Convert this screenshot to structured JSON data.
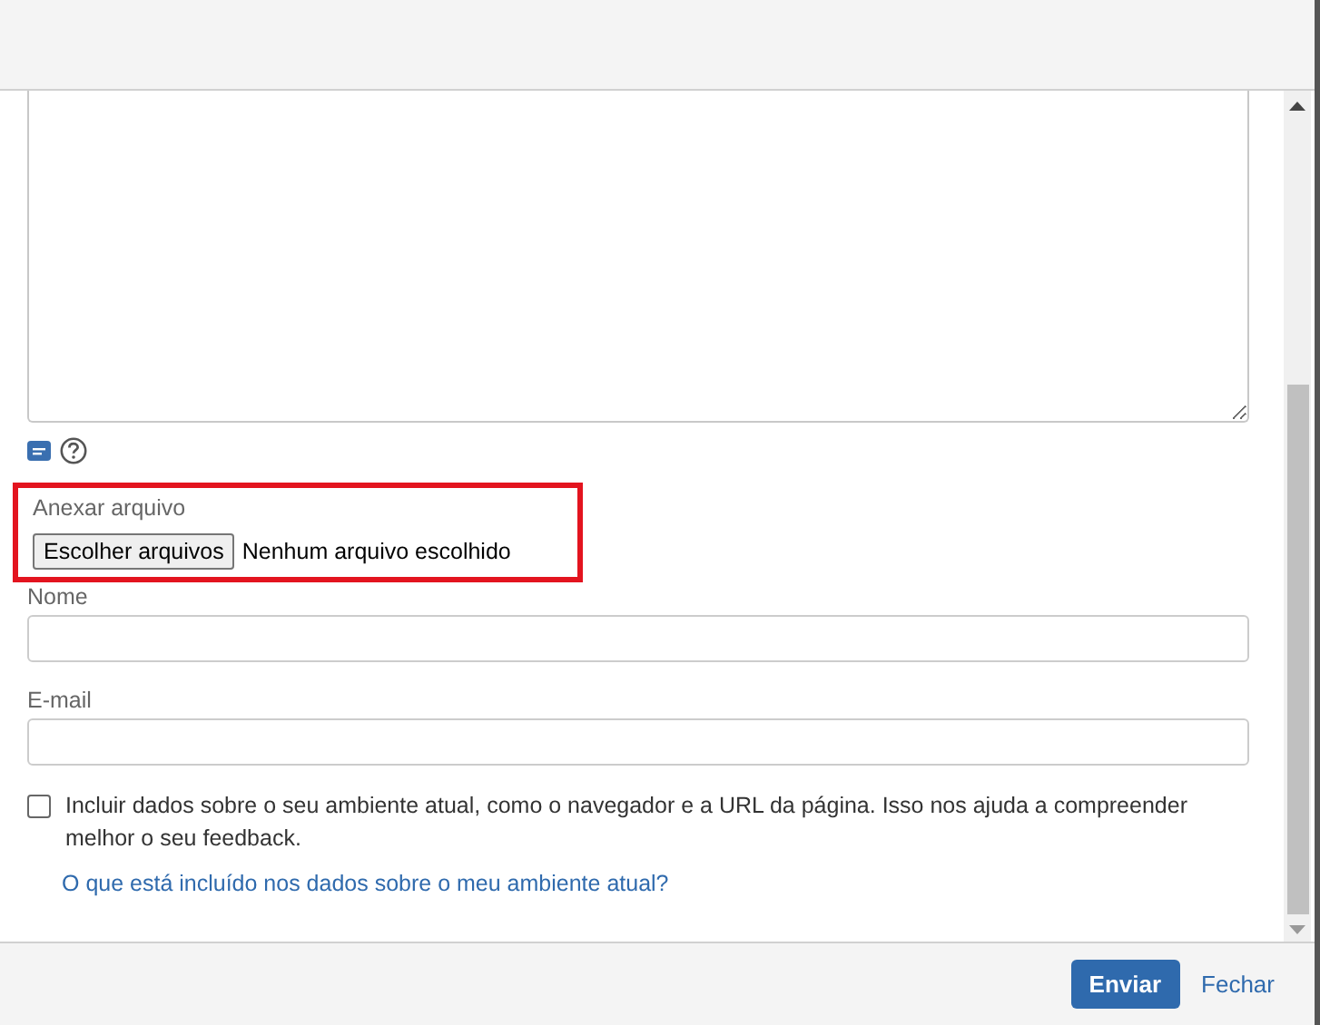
{
  "attachment": {
    "label": "Anexar arquivo",
    "button": "Escolher arquivos",
    "status": "Nenhum arquivo escolhido",
    "highlighted": true
  },
  "fields": [
    {
      "label": "Nome"
    },
    {
      "label": "E-mail"
    }
  ],
  "environment": {
    "checked": false,
    "text": "Incluir dados sobre o seu ambiente atual, como o navegador e a URL da página. Isso nos ajuda a compreender melhor o seu feedback.",
    "link": "O que está incluído nos dados sobre o meu ambiente atual?"
  },
  "buttons": [
    {
      "label": "Enviar",
      "kind": "primary"
    },
    {
      "label": "Fechar",
      "kind": "link"
    }
  ]
}
